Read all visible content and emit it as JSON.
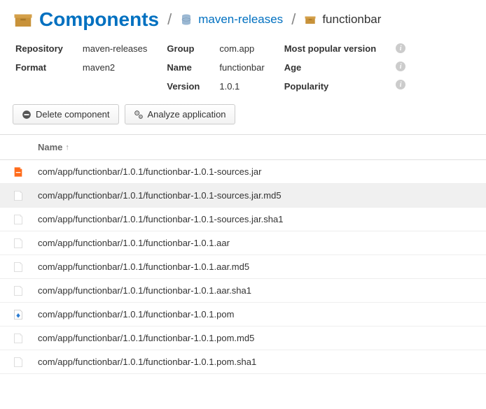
{
  "breadcrumb": {
    "title": "Components",
    "repo": "maven-releases",
    "component": "functionbar"
  },
  "meta": {
    "repository_label": "Repository",
    "repository_value": "maven-releases",
    "format_label": "Format",
    "format_value": "maven2",
    "group_label": "Group",
    "group_value": "com.app",
    "name_label": "Name",
    "name_value": "functionbar",
    "version_label": "Version",
    "version_value": "1.0.1",
    "popular_label": "Most popular version",
    "age_label": "Age",
    "popularity_label": "Popularity"
  },
  "actions": {
    "delete": "Delete component",
    "analyze": "Analyze application"
  },
  "table": {
    "header_name": "Name",
    "rows": [
      {
        "icon": "jar",
        "name": "com/app/functionbar/1.0.1/functionbar-1.0.1-sources.jar"
      },
      {
        "icon": "file",
        "name": "com/app/functionbar/1.0.1/functionbar-1.0.1-sources.jar.md5",
        "hover": true
      },
      {
        "icon": "file",
        "name": "com/app/functionbar/1.0.1/functionbar-1.0.1-sources.jar.sha1"
      },
      {
        "icon": "file",
        "name": "com/app/functionbar/1.0.1/functionbar-1.0.1.aar"
      },
      {
        "icon": "file",
        "name": "com/app/functionbar/1.0.1/functionbar-1.0.1.aar.md5"
      },
      {
        "icon": "file",
        "name": "com/app/functionbar/1.0.1/functionbar-1.0.1.aar.sha1"
      },
      {
        "icon": "pom",
        "name": "com/app/functionbar/1.0.1/functionbar-1.0.1.pom"
      },
      {
        "icon": "file",
        "name": "com/app/functionbar/1.0.1/functionbar-1.0.1.pom.md5"
      },
      {
        "icon": "file",
        "name": "com/app/functionbar/1.0.1/functionbar-1.0.1.pom.sha1"
      }
    ]
  }
}
